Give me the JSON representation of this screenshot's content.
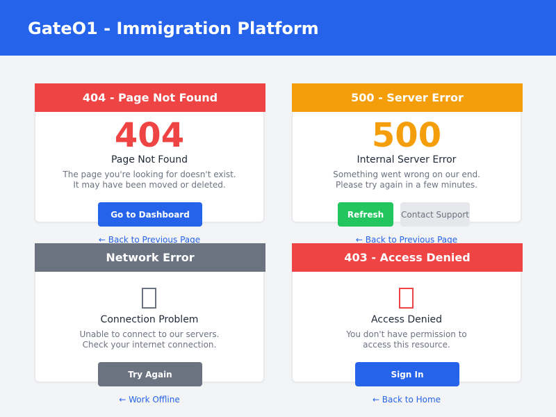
{
  "header": {
    "title": "GateO1 - Immigration Platform",
    "color": "#2563eb"
  },
  "cards": [
    {
      "header": "404 - Page Not Found",
      "color": "#ef4444",
      "code": "404",
      "subtitle": "Page Not Found",
      "message_line1": "The page you're looking for doesn't exist.",
      "message_line2": "It may have been moved or deleted.",
      "primary_button": "Go to Dashboard",
      "primary_button_color": "#2563eb",
      "link": "← Back to Previous Page"
    },
    {
      "header": "500 - Server Error",
      "color": "#f59e0b",
      "code": "500",
      "subtitle": "Internal Server Error",
      "message_line1": "Something went wrong on our end.",
      "message_line2": "Please try again in a few minutes.",
      "primary_button": "Refresh",
      "primary_button_color": "#22c55e",
      "secondary_button": "Contact Support",
      "link": "← Back to Previous Page"
    },
    {
      "header": "Network Error",
      "color": "#6b7280",
      "icon": "network-icon",
      "subtitle": "Connection Problem",
      "message_line1": "Unable to connect to our servers.",
      "message_line2": "Check your internet connection.",
      "primary_button": "Try Again",
      "primary_button_color": "#6b7280",
      "link": "← Work Offline"
    },
    {
      "header": "403 - Access Denied",
      "color": "#ef4444",
      "icon": "lock-icon",
      "subtitle": "Access Denied",
      "message_line1": "You don't have permission to",
      "message_line2": "access this resource.",
      "primary_button": "Sign In",
      "primary_button_color": "#2563eb",
      "link": "← Back to Home"
    }
  ]
}
